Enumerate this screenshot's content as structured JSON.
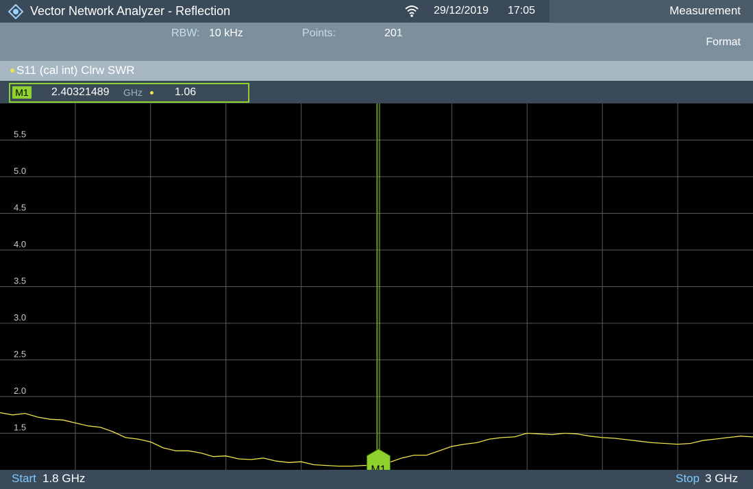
{
  "header": {
    "title": "Vector Network Analyzer - Reflection",
    "date": "29/12/2019",
    "time": "17:05",
    "rbw_label": "RBW:",
    "rbw_value": "10 kHz",
    "points_label": "Points:",
    "points_value": "201"
  },
  "softkeys": {
    "measurement": "Measurement",
    "format": "Format"
  },
  "trace": {
    "label": "S11 (cal int) Clrw SWR",
    "color": "#f0e44a"
  },
  "marker": {
    "name": "M1",
    "frequency": "2.40321489",
    "unit": "GHz",
    "value": "1.06",
    "color": "#8fd12e"
  },
  "footer": {
    "start_label": "Start",
    "start_value": "1.8 GHz",
    "stop_label": "Stop",
    "stop_value": "3 GHz"
  },
  "chart_data": {
    "type": "line",
    "x_range": [
      1.8,
      3.0
    ],
    "x_unit": "GHz",
    "ylim": [
      1.0,
      6.0
    ],
    "y_tick_labels": [
      "5.5",
      "5.0",
      "4.5",
      "4.0",
      "3.5",
      "3.0",
      "2.5",
      "2.0",
      "1.5"
    ],
    "y_ticks": [
      5.5,
      5.0,
      4.5,
      4.0,
      3.5,
      3.0,
      2.5,
      2.0,
      1.5
    ],
    "grid": true,
    "marker_x": 2.40321489,
    "marker_y": 1.06,
    "series": [
      {
        "x": [
          1.8,
          1.82,
          1.84,
          1.86,
          1.88,
          1.9,
          1.92,
          1.94,
          1.96,
          1.98,
          2.0,
          2.02,
          2.04,
          2.06,
          2.08,
          2.1,
          2.12,
          2.14,
          2.16,
          2.18,
          2.2,
          2.22,
          2.24,
          2.26,
          2.28,
          2.3,
          2.32,
          2.34,
          2.36,
          2.38,
          2.4,
          2.42,
          2.44,
          2.46,
          2.48,
          2.5,
          2.52,
          2.54,
          2.56,
          2.58,
          2.6,
          2.62,
          2.64,
          2.66,
          2.68,
          2.7,
          2.72,
          2.74,
          2.76,
          2.78,
          2.8,
          2.82,
          2.84,
          2.86,
          2.88,
          2.9,
          2.92,
          2.94,
          2.96,
          2.98,
          3.0
        ],
        "y": [
          1.78,
          1.75,
          1.77,
          1.72,
          1.69,
          1.68,
          1.64,
          1.6,
          1.58,
          1.52,
          1.44,
          1.42,
          1.38,
          1.3,
          1.26,
          1.26,
          1.23,
          1.18,
          1.19,
          1.15,
          1.14,
          1.16,
          1.12,
          1.1,
          1.11,
          1.07,
          1.06,
          1.05,
          1.05,
          1.06,
          1.06,
          1.1,
          1.16,
          1.2,
          1.2,
          1.26,
          1.32,
          1.35,
          1.37,
          1.42,
          1.44,
          1.45,
          1.5,
          1.49,
          1.48,
          1.5,
          1.49,
          1.46,
          1.44,
          1.43,
          1.41,
          1.39,
          1.37,
          1.36,
          1.35,
          1.36,
          1.4,
          1.42,
          1.44,
          1.46,
          1.45
        ]
      }
    ]
  }
}
